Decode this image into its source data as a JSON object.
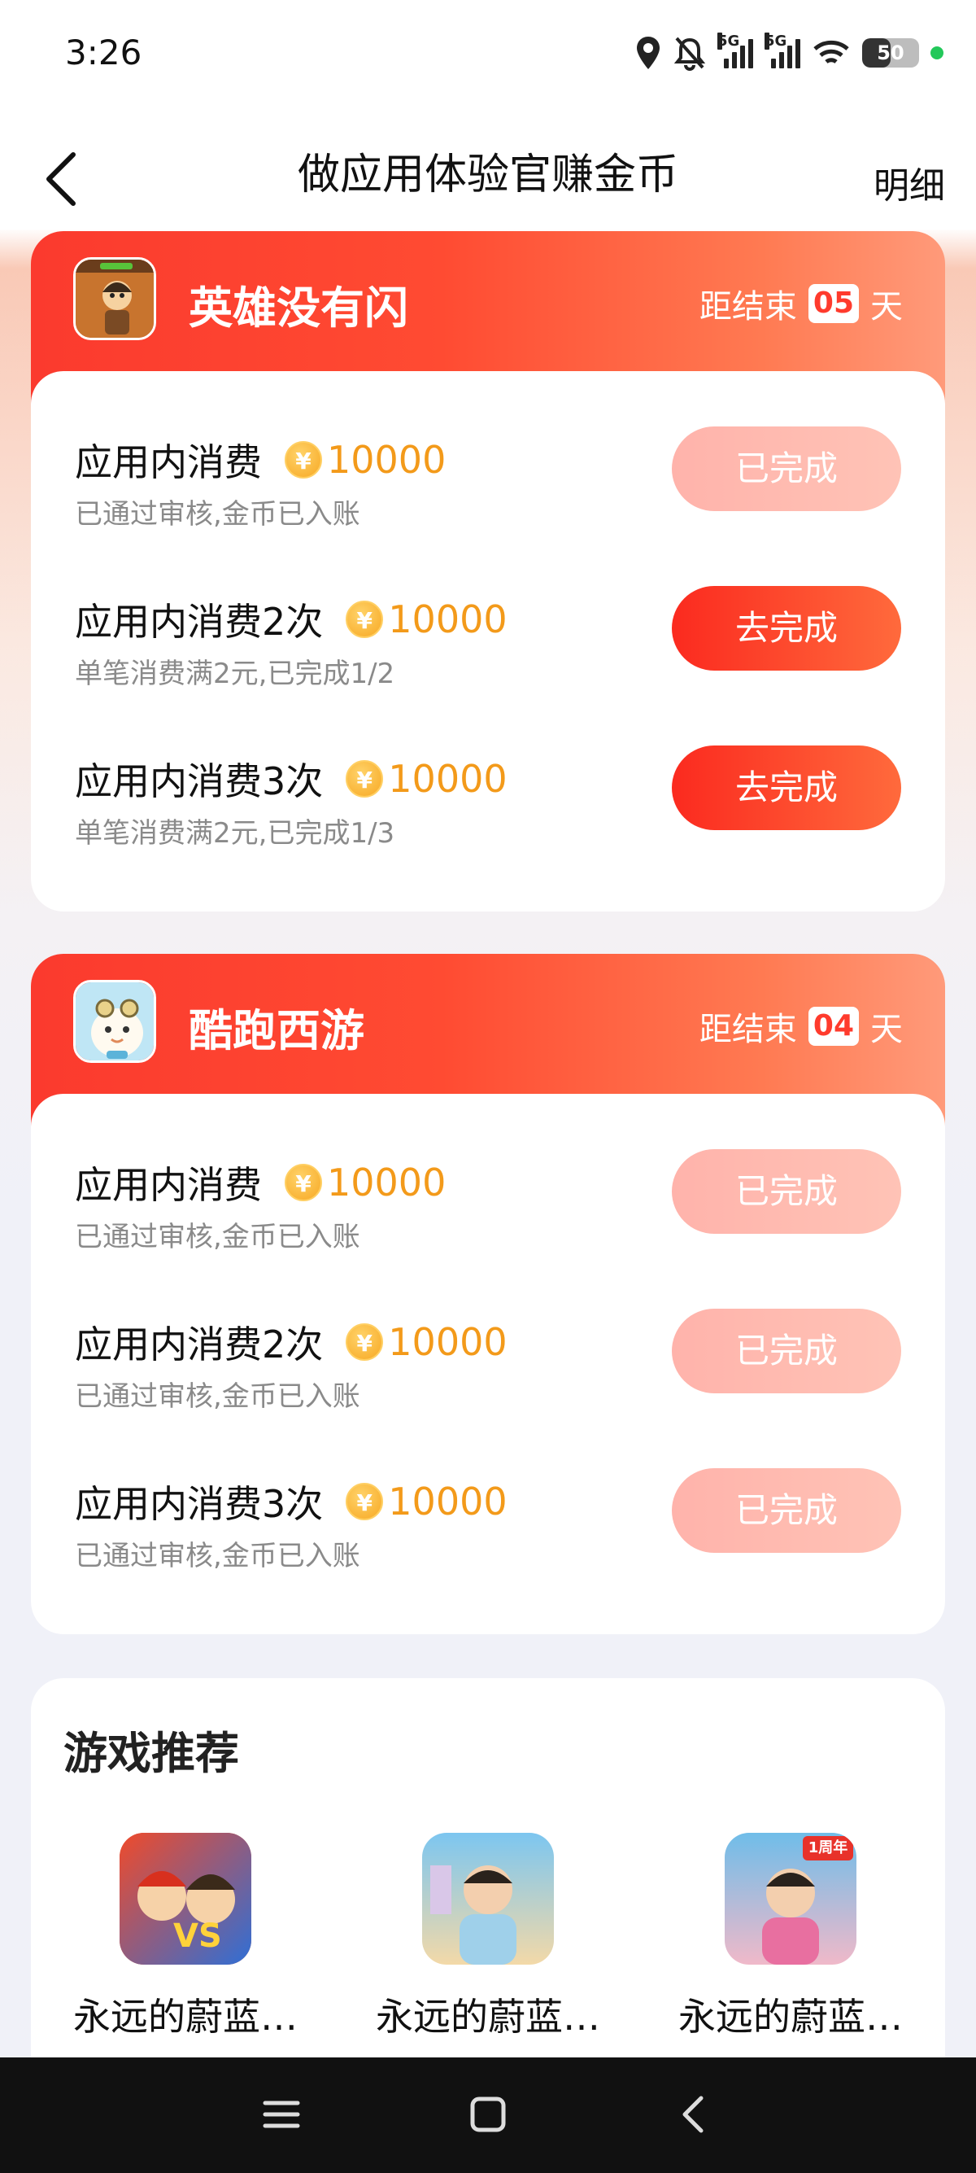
{
  "status": {
    "time": "3:26",
    "network_label": "5G",
    "battery": "50",
    "battery_level": 0.5,
    "icons": [
      "location-icon",
      "mute-bell-icon",
      "signal-icon",
      "signal-icon",
      "wifi-icon",
      "battery-icon"
    ]
  },
  "header": {
    "title": "做应用体验官赚金币",
    "detail": "明细",
    "back_icon": "chevron-left-icon"
  },
  "cards": [
    {
      "app_name": "英雄没有闪",
      "countdown_prefix": "距结束",
      "days": "05",
      "countdown_suffix": "天",
      "tasks": [
        {
          "title": "应用内消费",
          "reward": "10000",
          "sub": "已通过审核,金币已入账",
          "button": "已完成",
          "state": "done"
        },
        {
          "title": "应用内消费2次",
          "reward": "10000",
          "sub": "单笔消费满2元,已完成1/2",
          "button": "去完成",
          "state": "todo"
        },
        {
          "title": "应用内消费3次",
          "reward": "10000",
          "sub": "单笔消费满2元,已完成1/3",
          "button": "去完成",
          "state": "todo"
        }
      ]
    },
    {
      "app_name": "酷跑西游",
      "countdown_prefix": "距结束",
      "days": "04",
      "countdown_suffix": "天",
      "tasks": [
        {
          "title": "应用内消费",
          "reward": "10000",
          "sub": "已通过审核,金币已入账",
          "button": "已完成",
          "state": "done"
        },
        {
          "title": "应用内消费2次",
          "reward": "10000",
          "sub": "已通过审核,金币已入账",
          "button": "已完成",
          "state": "done"
        },
        {
          "title": "应用内消费3次",
          "reward": "10000",
          "sub": "已通过审核,金币已入账",
          "button": "已完成",
          "state": "done"
        }
      ]
    }
  ],
  "coin_symbol": "¥",
  "recommend": {
    "title": "游戏推荐",
    "games": [
      {
        "name": "永远的蔚蓝…"
      },
      {
        "name": "永远的蔚蓝…"
      },
      {
        "name": "永远的蔚蓝…",
        "badge": "1周年"
      }
    ]
  },
  "colors": {
    "accent": "#fb3a2e",
    "reward": "#f39a1a",
    "done_button": "#ffb9b0"
  }
}
